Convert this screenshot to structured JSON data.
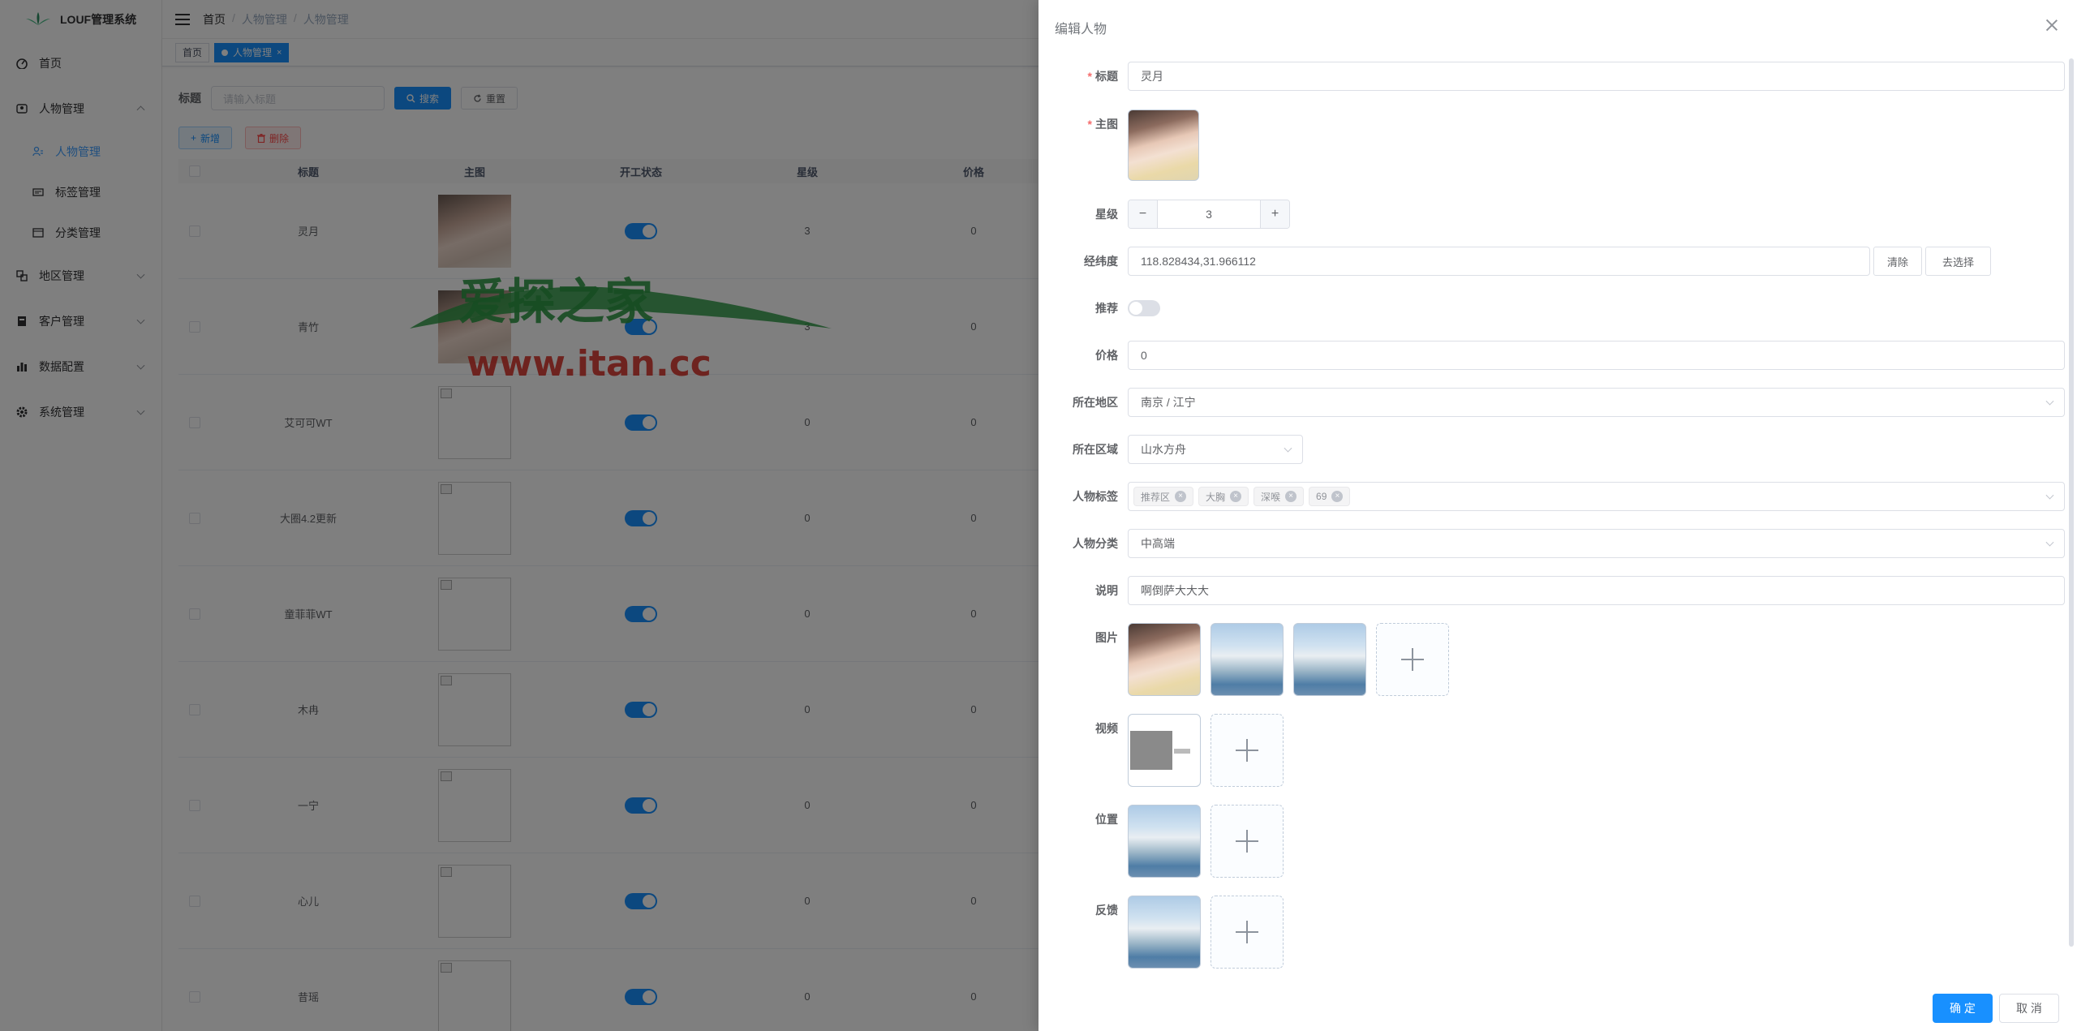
{
  "app": {
    "title": "LOUF管理系统"
  },
  "sidebar": {
    "items": [
      {
        "label": "首页",
        "icon": "dashboard-icon"
      },
      {
        "label": "人物管理",
        "icon": "people-icon",
        "expanded": true,
        "children": [
          {
            "label": "人物管理",
            "icon": "person-icon",
            "active": true
          },
          {
            "label": "标签管理",
            "icon": "tag-icon"
          },
          {
            "label": "分类管理",
            "icon": "category-icon"
          }
        ]
      },
      {
        "label": "地区管理",
        "icon": "region-icon"
      },
      {
        "label": "客户管理",
        "icon": "customer-icon"
      },
      {
        "label": "数据配置",
        "icon": "chart-icon"
      },
      {
        "label": "系统管理",
        "icon": "gear-icon"
      }
    ]
  },
  "breadcrumb": [
    "首页",
    "人物管理",
    "人物管理"
  ],
  "tags_view": {
    "home": "首页",
    "active": "人物管理"
  },
  "search": {
    "label": "标题",
    "placeholder": "请输入标题",
    "search_btn": "搜索",
    "reset_btn": "重置"
  },
  "actions": {
    "add": "新增",
    "delete": "删除"
  },
  "table": {
    "headers": [
      "标题",
      "主图",
      "开工状态",
      "星级",
      "价格"
    ],
    "rows": [
      {
        "title": "灵月",
        "star": "3",
        "price": "0",
        "has_photo": true
      },
      {
        "title": "青竹",
        "star": "3",
        "price": "0",
        "has_photo": true
      },
      {
        "title": "艾可可WT",
        "star": "0",
        "price": "0",
        "has_photo": false
      },
      {
        "title": "大圈4.2更新",
        "star": "0",
        "price": "0",
        "has_photo": false
      },
      {
        "title": "童菲菲WT",
        "star": "0",
        "price": "0",
        "has_photo": false
      },
      {
        "title": "木冉",
        "star": "0",
        "price": "0",
        "has_photo": false
      },
      {
        "title": "一宁",
        "star": "0",
        "price": "0",
        "has_photo": false
      },
      {
        "title": "心儿",
        "star": "0",
        "price": "0",
        "has_photo": false
      },
      {
        "title": "昔瑶",
        "star": "0",
        "price": "0",
        "has_photo": false
      }
    ]
  },
  "watermark": {
    "line1": "爱探之家",
    "line2": "www.itan.cc"
  },
  "drawer": {
    "title": "编辑人物",
    "fields": {
      "title": {
        "label": "标题",
        "value": "灵月"
      },
      "main_image": {
        "label": "主图"
      },
      "star": {
        "label": "星级",
        "value": "3"
      },
      "coords": {
        "label": "经纬度",
        "value": "118.828434,31.966112",
        "clear_btn": "清除",
        "choose_btn": "去选择"
      },
      "recommend": {
        "label": "推荐",
        "on": false
      },
      "price": {
        "label": "价格",
        "value": "0"
      },
      "region": {
        "label": "所在地区",
        "value": "南京 / 江宁"
      },
      "area": {
        "label": "所在区域",
        "value": "山水方舟"
      },
      "tags": {
        "label": "人物标签",
        "values": [
          "推荐区",
          "大胸",
          "深喉",
          "69"
        ]
      },
      "category": {
        "label": "人物分类",
        "value": "中高端"
      },
      "desc": {
        "label": "说明",
        "value": "啊倒萨大大大"
      },
      "images": {
        "label": "图片"
      },
      "video": {
        "label": "视频"
      },
      "location": {
        "label": "位置"
      },
      "feedback": {
        "label": "反馈"
      }
    },
    "confirm": "确 定",
    "cancel": "取 消"
  },
  "colors": {
    "primary": "#1890ff",
    "danger": "#ff4949",
    "required": "#f56c6c"
  }
}
